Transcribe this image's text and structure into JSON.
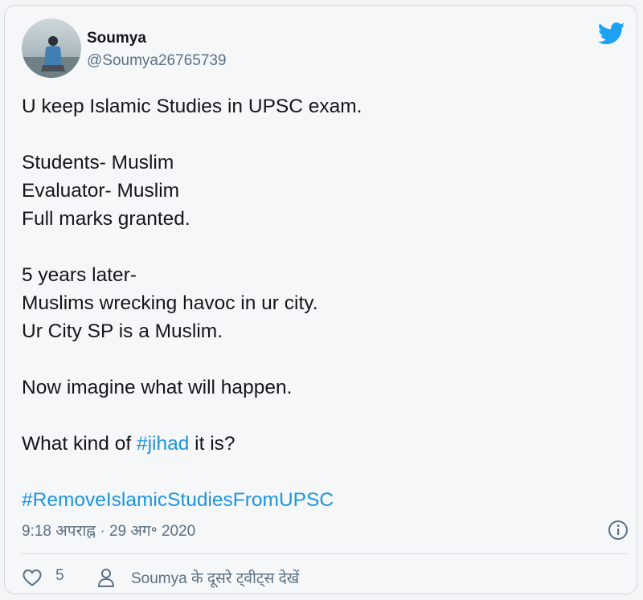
{
  "tweet": {
    "author_name": "Soumya",
    "author_handle": "@Soumya26765739",
    "lines": [
      "U keep Islamic Studies in UPSC exam.",
      "",
      "Students- Muslim",
      "Evaluator- Muslim",
      "Full marks granted.",
      "",
      "5 years later-",
      "Muslims wrecking havoc in ur city.",
      "Ur City SP is a Muslim.",
      "",
      "Now imagine what will happen.",
      ""
    ],
    "question_prefix": "What kind of ",
    "hashtag_inline": "#jihad",
    "question_suffix": " it is?",
    "hashtag_final": "#RemoveIslamicStudiesFromUPSC",
    "timestamp": "9:18 अपराह्न · 29 अग॰ 2020",
    "like_count": "5",
    "more_tweets_label": "Soumya के दूसरे ट्वीट्स देखें"
  },
  "icons": {
    "brand": "twitter-bird-icon",
    "info": "info-icon",
    "like": "heart-icon",
    "user": "user-icon"
  },
  "colors": {
    "link": "#1b95e0",
    "secondary_text": "#5b7083",
    "brand_blue": "#1da1f2"
  }
}
